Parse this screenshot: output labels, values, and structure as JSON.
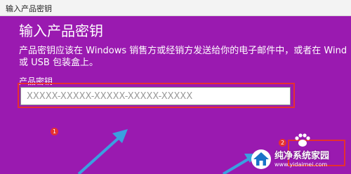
{
  "window": {
    "title": "输入产品密钥"
  },
  "dialog": {
    "heading": "输入产品密钥",
    "description_line1": "产品密钥应该在 Windows 销售方或经销方发送给你的电子邮件中，或者在 Wind",
    "description_line2": "或 USB 包装盒上。",
    "field_label": "产品密钥",
    "key_placeholder": "XXXXX-XXXXX-XXXXX-XXXXX-XXXXX",
    "key_value": ""
  },
  "annotations": {
    "step1": "1",
    "step2": "2",
    "highlight_color": "#e53030",
    "arrow_color": "#3aa0e0"
  },
  "watermark": {
    "title": "纯净系统家园",
    "url": "www.yidaimei.com"
  },
  "colors": {
    "background": "#9a1ab0",
    "titlebar": "#f3f3f3",
    "text": "#ffffff"
  }
}
